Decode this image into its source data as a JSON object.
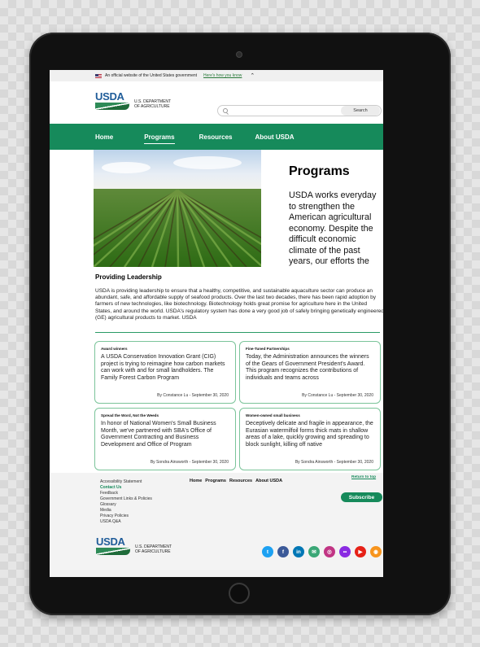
{
  "gov_banner": {
    "text": "An official website of the United States government",
    "link": "Here's how you know"
  },
  "logo": {
    "word": "USDA",
    "line1": "U.S. DEPARTMENT",
    "line2": "OF AGRICULTURE"
  },
  "search": {
    "placeholder": "",
    "button": "Search"
  },
  "nav": {
    "items": [
      "Home",
      "Programs",
      "Resources",
      "About USDA"
    ],
    "active": "Programs"
  },
  "hero": {
    "title": "Programs",
    "text": "USDA works everyday to strengthen the American agricultural economy. Despite the difficult economic climate of the past years, our efforts the"
  },
  "leadership": {
    "heading": "Providing Leadership",
    "body": "USDA is providing leadership to ensure that a healthy, competitive, and sustainable aquaculture sector can produce an abundant, safe, and affordable supply of seafood products. Over the last two decades, there has been rapid adoption by farmers of new technologies, like biotechnology. Biotechnology holds great promise for agriculture here in the United States, and around the world. USDA's regulatory system has done a very good job of safely bringing genetically engineered (GE) agricultural products to market.  USDA"
  },
  "cards": [
    {
      "tag": "Award winners",
      "body": "A USDA Conservation Innovation Grant (CIG) project is trying to reimagine how carbon markets can work with and for small landholders. The Family Forest Carbon Program",
      "byline": "By Constance Lu - September 30, 2020"
    },
    {
      "tag": "Fine-Tuned Partnerships",
      "body": "Today, the Administration announces the winners of the Gears of Government President's Award. This program recognizes the contributions of individuals and teams across",
      "byline": "By Constance Lu - September 30, 2020"
    },
    {
      "tag": "Spread the Word, Not the Weeds",
      "body": "In honor of National Women's Small Business Month, we've partnered with SBA's Office of Government Contracting and Business Development and Office of Program",
      "byline": "By Sondra Ainsworth - September 30, 2020"
    },
    {
      "tag": "Women-owned small business",
      "body": "Deceptively delicate and fragile in appearance, the Eurasian watermilfoil forms thick mats in shallow areas of a lake, quickly growing and spreading to block sunlight, killing off native",
      "byline": "By Sondra Ainsworth - September 30, 2020"
    }
  ],
  "footer": {
    "links": [
      "Accessibility Statement",
      "Contact Us",
      "Feedback",
      "Government Links & Policies",
      "Glossary",
      "Media",
      "Privacy Policies",
      "USDA Q&A"
    ],
    "nav": [
      "Home",
      "Programs",
      "Resources",
      "About USDA"
    ],
    "return_top": "Return to top",
    "subscribe": "Subscribe",
    "socials": [
      {
        "name": "twitter-icon",
        "glyph": "t",
        "color": "#1da1f2"
      },
      {
        "name": "facebook-icon",
        "glyph": "f",
        "color": "#3b5998"
      },
      {
        "name": "linkedin-icon",
        "glyph": "in",
        "color": "#0077b5"
      },
      {
        "name": "email-icon",
        "glyph": "✉",
        "color": "#3aa776"
      },
      {
        "name": "instagram-icon",
        "glyph": "◎",
        "color": "#c13584"
      },
      {
        "name": "flickr-icon",
        "glyph": "••",
        "color": "#8a2be2"
      },
      {
        "name": "youtube-icon",
        "glyph": "▶",
        "color": "#e62117"
      },
      {
        "name": "rss-icon",
        "glyph": "◉",
        "color": "#f7941d"
      }
    ]
  },
  "colors": {
    "brand_green": "#168a5b",
    "usda_blue": "#1f5c99"
  }
}
